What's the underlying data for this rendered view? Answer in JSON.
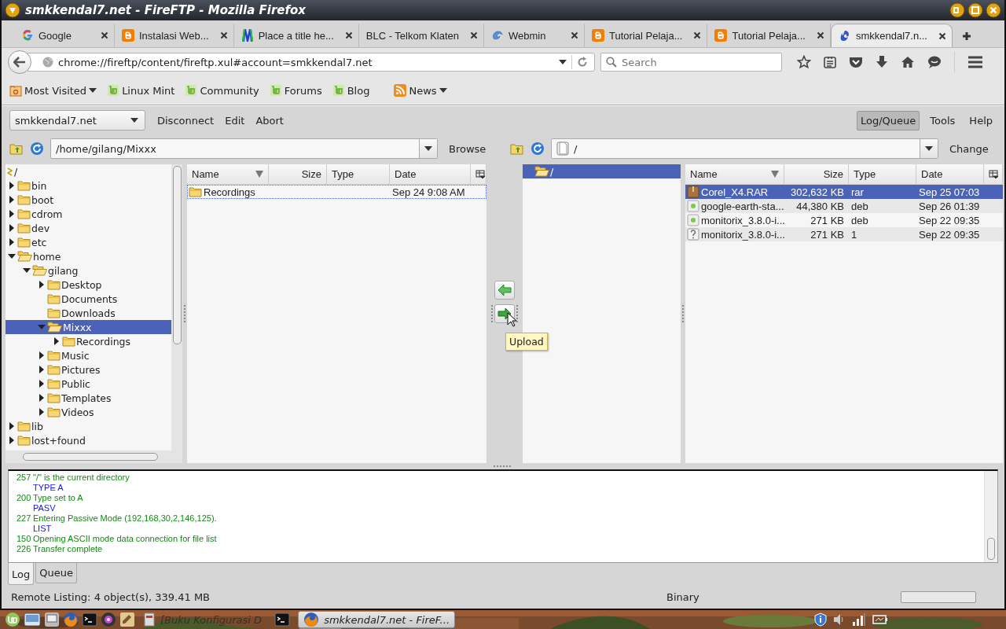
{
  "window": {
    "title": "smkkendal7.net - FireFTP - Mozilla Firefox"
  },
  "tabs": [
    {
      "label": "Google",
      "kind": "google",
      "selected": false
    },
    {
      "label": "Instalasi Web...",
      "kind": "blogger",
      "selected": false
    },
    {
      "label": "Place a title he...",
      "kind": "m",
      "selected": false
    },
    {
      "label": "BLC - Telkom Klaten",
      "kind": "plain",
      "selected": false
    },
    {
      "label": "Webmin",
      "kind": "webmin",
      "selected": false
    },
    {
      "label": "Tutorial Pelaja...",
      "kind": "blogger",
      "selected": false
    },
    {
      "label": "Tutorial Pelaja...",
      "kind": "blogger",
      "selected": false
    },
    {
      "label": "smkkendal7.n...",
      "kind": "fireftp",
      "selected": true
    }
  ],
  "navbar": {
    "url": "chrome://fireftp/content/fireftp.xul#account=smkkendal7.net",
    "search_placeholder": "Search"
  },
  "bookmarks": [
    {
      "label": "Most Visited",
      "kind": "folder",
      "dropdown": true
    },
    {
      "label": "Linux Mint",
      "kind": "mint",
      "dropdown": false
    },
    {
      "label": "Community",
      "kind": "mint",
      "dropdown": false
    },
    {
      "label": "Forums",
      "kind": "mint",
      "dropdown": false
    },
    {
      "label": "Blog",
      "kind": "mint",
      "dropdown": false
    },
    {
      "label": "News",
      "kind": "rss",
      "dropdown": true
    }
  ],
  "ftp_toolbar": {
    "account": "smkkendal7.net",
    "actions": [
      "Disconnect",
      "Edit",
      "Abort"
    ],
    "panels": [
      {
        "label": "Log/Queue",
        "pressed": true
      },
      {
        "label": "Tools",
        "pressed": false
      },
      {
        "label": "Help",
        "pressed": false
      }
    ]
  },
  "local": {
    "path": "/home/gilang/Mixxx",
    "button": "Browse",
    "tree": [
      {
        "label": "/",
        "kind": "root",
        "selected": false
      },
      {
        "label": "bin",
        "kind": "branch",
        "expanded": false,
        "selected": false
      },
      {
        "label": "boot",
        "kind": "branch",
        "expanded": false,
        "selected": false
      },
      {
        "label": "cdrom",
        "kind": "branch",
        "expanded": false,
        "selected": false
      },
      {
        "label": "dev",
        "kind": "branch",
        "expanded": false,
        "selected": false
      },
      {
        "label": "etc",
        "kind": "branch",
        "expanded": false,
        "selected": false
      },
      {
        "label": "home",
        "kind": "branch",
        "expanded": true,
        "selected": false,
        "children": [
          {
            "label": "gilang",
            "kind": "branch",
            "expanded": true,
            "selected": false,
            "children": [
              {
                "label": "Desktop",
                "kind": "branch",
                "expanded": false,
                "selected": false
              },
              {
                "label": "Documents",
                "kind": "leaf",
                "selected": false
              },
              {
                "label": "Downloads",
                "kind": "leaf",
                "selected": false
              },
              {
                "label": "Mixxx",
                "kind": "branch",
                "expanded": true,
                "selected": true,
                "children": [
                  {
                    "label": "Recordings",
                    "kind": "branch",
                    "expanded": false,
                    "selected": false
                  }
                ]
              },
              {
                "label": "Music",
                "kind": "branch",
                "expanded": false,
                "selected": false
              },
              {
                "label": "Pictures",
                "kind": "branch",
                "expanded": false,
                "selected": false
              },
              {
                "label": "Public",
                "kind": "branch",
                "expanded": false,
                "selected": false
              },
              {
                "label": "Templates",
                "kind": "branch",
                "expanded": false,
                "selected": false
              },
              {
                "label": "Videos",
                "kind": "branch",
                "expanded": false,
                "selected": false
              }
            ]
          }
        ]
      },
      {
        "label": "lib",
        "kind": "branch",
        "expanded": false,
        "selected": false
      },
      {
        "label": "lost+found",
        "kind": "branch",
        "expanded": false,
        "selected": false
      }
    ],
    "columns": [
      {
        "label": "Name",
        "sorted": true
      },
      {
        "label": "Size",
        "sorted": false
      },
      {
        "label": "Type",
        "sorted": false
      },
      {
        "label": "Date",
        "sorted": false
      }
    ],
    "rows": [
      {
        "name": "Recordings",
        "kind": "folder",
        "date": "Sep 24 9:08 AM",
        "selected": false,
        "focused": true
      }
    ]
  },
  "transfer": {
    "buttons": [
      {
        "kind": "download",
        "hovered": false
      },
      {
        "kind": "upload",
        "hovered": true
      }
    ],
    "tooltip": "Upload"
  },
  "remote": {
    "path": "/",
    "button": "Change",
    "tree": [
      {
        "label": "/",
        "kind": "folder",
        "selected": true
      }
    ],
    "columns": [
      {
        "label": "Name",
        "sorted": true
      },
      {
        "label": "Size",
        "sorted": false
      },
      {
        "label": "Type",
        "sorted": false
      },
      {
        "label": "Date",
        "sorted": false
      }
    ],
    "rows": [
      {
        "name": "Corel_X4.RAR",
        "kind": "archive",
        "size": "302,632 KB",
        "type": "rar",
        "date": "Sep 25 07:03",
        "selected": true,
        "focused": false
      },
      {
        "name": "google-earth-sta...",
        "kind": "package",
        "size": "44,380 KB",
        "type": "deb",
        "date": "Sep 26 01:39",
        "selected": false,
        "focused": false
      },
      {
        "name": "monitorix_3.8.0-i...",
        "kind": "package",
        "size": "271 KB",
        "type": "deb",
        "date": "Sep 22 09:35",
        "selected": false,
        "focused": false
      },
      {
        "name": "monitorix_3.8.0-i...",
        "kind": "unknown",
        "size": "271 KB",
        "type": "1",
        "date": "Sep 22 09:35",
        "selected": false,
        "focused": false
      }
    ]
  },
  "log": {
    "lines": [
      {
        "kind": "response",
        "code": "257",
        "text": "\"/\" is the current directory"
      },
      {
        "kind": "command",
        "text": "TYPE A"
      },
      {
        "kind": "response",
        "code": "200",
        "text": "Type set to A"
      },
      {
        "kind": "command",
        "text": "PASV"
      },
      {
        "kind": "response",
        "code": "227",
        "text": "Entering Passive Mode (192,168,30,2,146,125)."
      },
      {
        "kind": "command",
        "text": "LIST"
      },
      {
        "kind": "response",
        "code": "150",
        "text": "Opening ASCII mode data connection for file list"
      },
      {
        "kind": "response",
        "code": "226",
        "text": "Transfer complete"
      }
    ],
    "tabs": [
      {
        "label": "Log",
        "selected": true
      },
      {
        "label": "Queue",
        "selected": false
      }
    ]
  },
  "status": {
    "listing": "Remote Listing: 4 object(s), 339.41 MB",
    "mode": "Binary",
    "progress": {
      "level": 0
    }
  },
  "taskbar": {
    "launchers": [
      {
        "kind": "menu"
      },
      {
        "kind": "desktop"
      },
      {
        "kind": "monitor"
      },
      {
        "kind": "firefox"
      },
      {
        "kind": "terminal"
      },
      {
        "kind": "disc"
      },
      {
        "kind": "notes"
      }
    ],
    "windows": [
      {
        "kind": "document",
        "label": "[Buku Konfigurasi D",
        "active": false
      },
      {
        "kind": "terminal",
        "active": false
      },
      {
        "kind": "firefox",
        "label": "smkkendal7.net - FireF...",
        "active": true
      }
    ],
    "tray": [
      {
        "kind": "shield"
      },
      {
        "kind": "volume"
      },
      {
        "kind": "signal"
      },
      {
        "kind": "battery"
      }
    ]
  }
}
